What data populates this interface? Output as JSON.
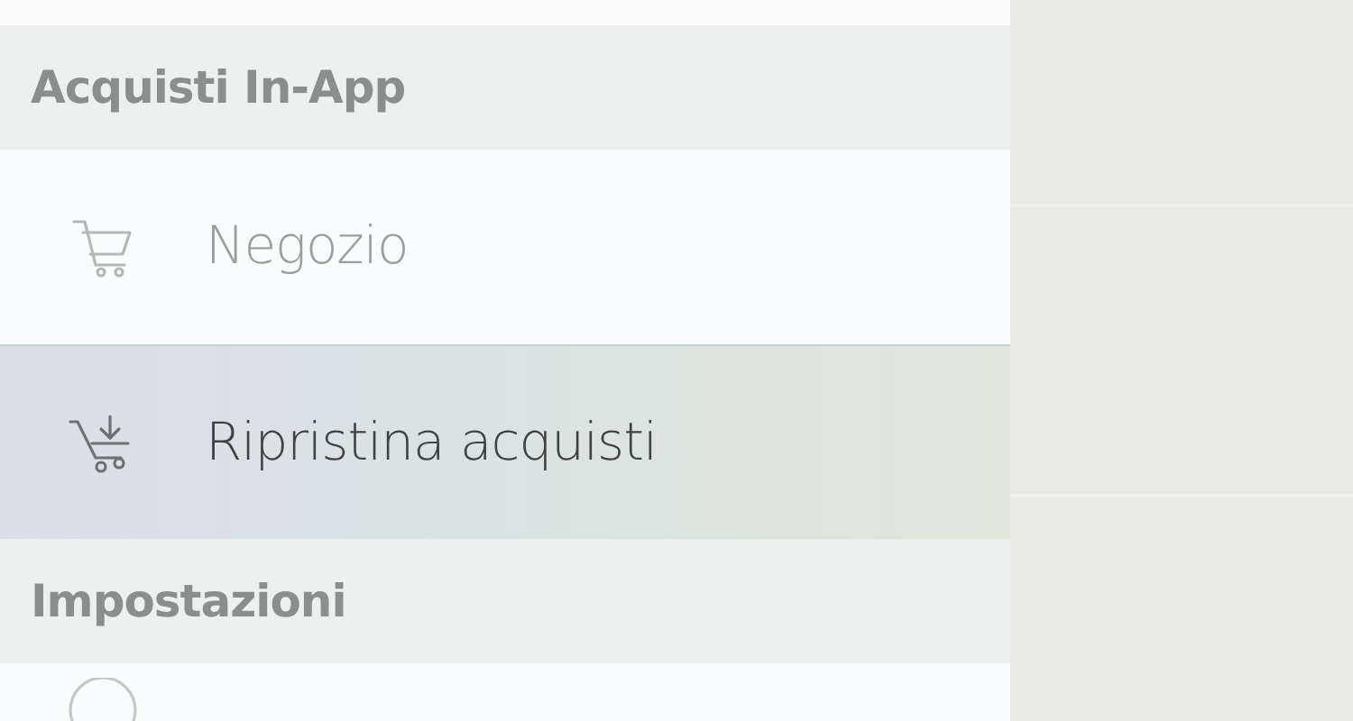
{
  "sections": [
    {
      "header": "Acquisti In-App",
      "items": [
        {
          "kind": "cart",
          "label": "Negozio",
          "selected": false,
          "disabled": true
        },
        {
          "kind": "cart-download",
          "label": "Ripristina acquisti",
          "selected": true,
          "disabled": false
        }
      ]
    },
    {
      "header": "Impostazioni",
      "items": [
        {
          "kind": "circle",
          "selected": false
        }
      ]
    }
  ]
}
